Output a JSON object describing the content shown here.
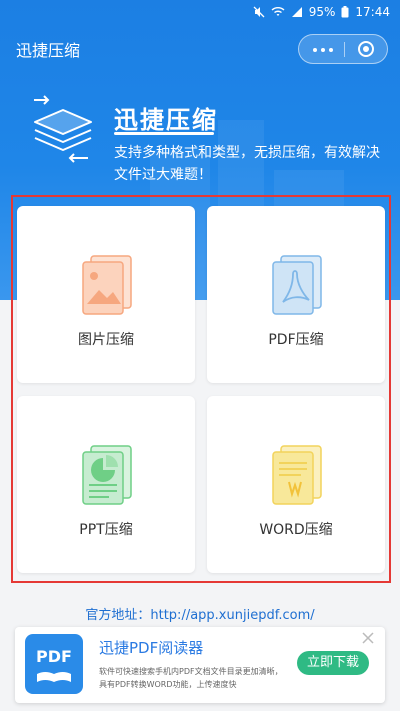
{
  "status_bar": {
    "battery": "95%",
    "time": "17:44"
  },
  "nav": {
    "title": "迅捷压缩"
  },
  "hero": {
    "title": "迅捷压缩",
    "description": "支持多种格式和类型，无损压缩，有效解决文件过大难题！"
  },
  "cards": [
    {
      "label": "图片压缩",
      "icon": "image-file-icon",
      "color": "#f6a77f"
    },
    {
      "label": "PDF压缩",
      "icon": "pdf-file-icon",
      "color": "#7fb7e8"
    },
    {
      "label": "PPT压缩",
      "icon": "ppt-file-icon",
      "color": "#6fcf86"
    },
    {
      "label": "WORD压缩",
      "icon": "word-file-icon",
      "color": "#f2d35b"
    }
  ],
  "official": {
    "text": "官方地址：http://app.xunjiepdf.com/"
  },
  "ad": {
    "icon_text": "PDF",
    "title": "迅捷PDF阅读器",
    "description": "软件可快速搜索手机内PDF文档文件目录更加清晰，具有PDF转换WORD功能，上传速度快",
    "button": "立即下载"
  },
  "colors": {
    "header_blue": "#1f86e8",
    "frame_red": "#e53935",
    "link_blue": "#1f6fd1",
    "button_green": "#2fba84"
  }
}
